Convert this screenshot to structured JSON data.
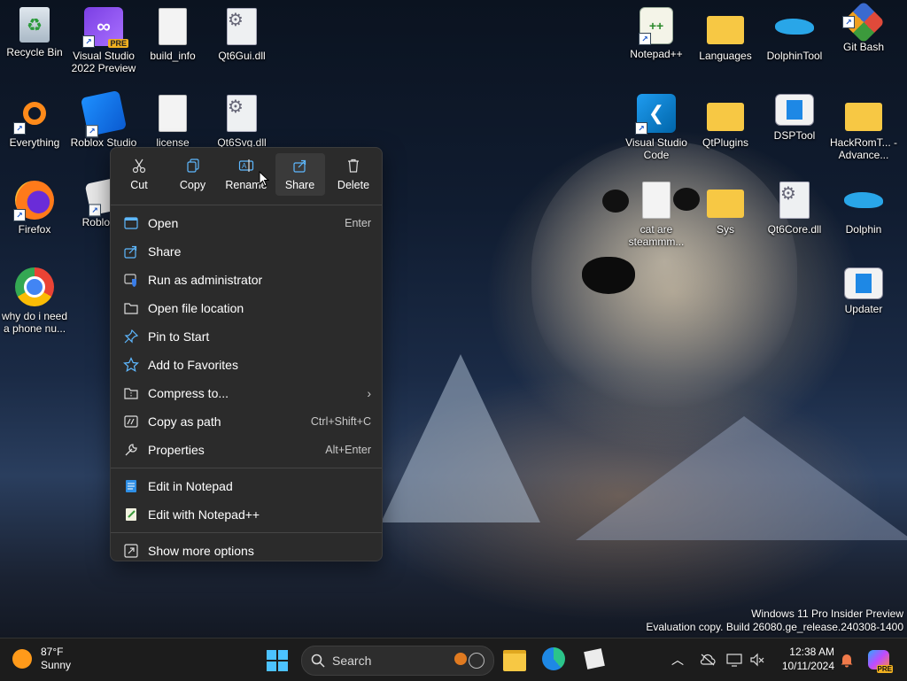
{
  "desktop_icons": [
    {
      "label": "Recycle Bin"
    },
    {
      "label": "Visual Studio 2022 Preview",
      "badge": "PRE"
    },
    {
      "label": "build_info"
    },
    {
      "label": "Qt6Gui.dll"
    },
    {
      "label": "Everything"
    },
    {
      "label": "Roblox Studio"
    },
    {
      "label": "license"
    },
    {
      "label": "Qt6Svg.dll"
    },
    {
      "label": "Firefox"
    },
    {
      "label": "Roblox P"
    },
    {
      "label": "why do i need a phone nu..."
    },
    {
      "label": "Notepad++"
    },
    {
      "label": "Languages"
    },
    {
      "label": "DolphinTool"
    },
    {
      "label": "Git Bash"
    },
    {
      "label": "Visual Studio Code"
    },
    {
      "label": "QtPlugins"
    },
    {
      "label": "DSPTool"
    },
    {
      "label": "HackRomT... - Advance..."
    },
    {
      "label": "cat are steammm..."
    },
    {
      "label": "Sys"
    },
    {
      "label": "Qt6Core.dll"
    },
    {
      "label": "Dolphin"
    },
    {
      "label": "Updater"
    }
  ],
  "context_menu": {
    "quick_actions": [
      {
        "label": "Cut",
        "icon": "scissors-icon"
      },
      {
        "label": "Copy",
        "icon": "copy-icon"
      },
      {
        "label": "Rename",
        "icon": "rename-icon"
      },
      {
        "label": "Share",
        "icon": "share-icon"
      },
      {
        "label": "Delete",
        "icon": "trash-icon"
      }
    ],
    "items": [
      {
        "label": "Open",
        "shortcut": "Enter",
        "icon": "open-icon"
      },
      {
        "label": "Share",
        "shortcut": "",
        "icon": "share-icon"
      },
      {
        "label": "Run as administrator",
        "shortcut": "",
        "icon": "shield-icon"
      },
      {
        "label": "Open file location",
        "shortcut": "",
        "icon": "folder-icon"
      },
      {
        "label": "Pin to Start",
        "shortcut": "",
        "icon": "pin-icon"
      },
      {
        "label": "Add to Favorites",
        "shortcut": "",
        "icon": "star-icon"
      },
      {
        "label": "Compress to...",
        "shortcut": "",
        "icon": "archive-icon",
        "submenu": true
      },
      {
        "label": "Copy as path",
        "shortcut": "Ctrl+Shift+C",
        "icon": "path-icon"
      },
      {
        "label": "Properties",
        "shortcut": "Alt+Enter",
        "icon": "wrench-icon"
      },
      {
        "label": "Edit in Notepad",
        "shortcut": "",
        "icon": "notepad-icon"
      },
      {
        "label": "Edit with Notepad++",
        "shortcut": "",
        "icon": "notepadpp-icon"
      },
      {
        "label": "Show more options",
        "shortcut": "",
        "icon": "more-options-icon"
      }
    ]
  },
  "watermark": {
    "line1": "Windows 11 Pro Insider Preview",
    "line2": "Evaluation copy. Build 26080.ge_release.240308-1400"
  },
  "taskbar": {
    "weather_temp": "87°F",
    "weather_desc": "Sunny",
    "search_placeholder": "Search",
    "time": "12:38 AM",
    "date": "10/11/2024",
    "copilot_badge": "PRE"
  },
  "colors": {
    "menu_bg": "#2b2b2b",
    "taskbar_bg": "#1c1c1c",
    "accent": "#4cc2ff"
  }
}
